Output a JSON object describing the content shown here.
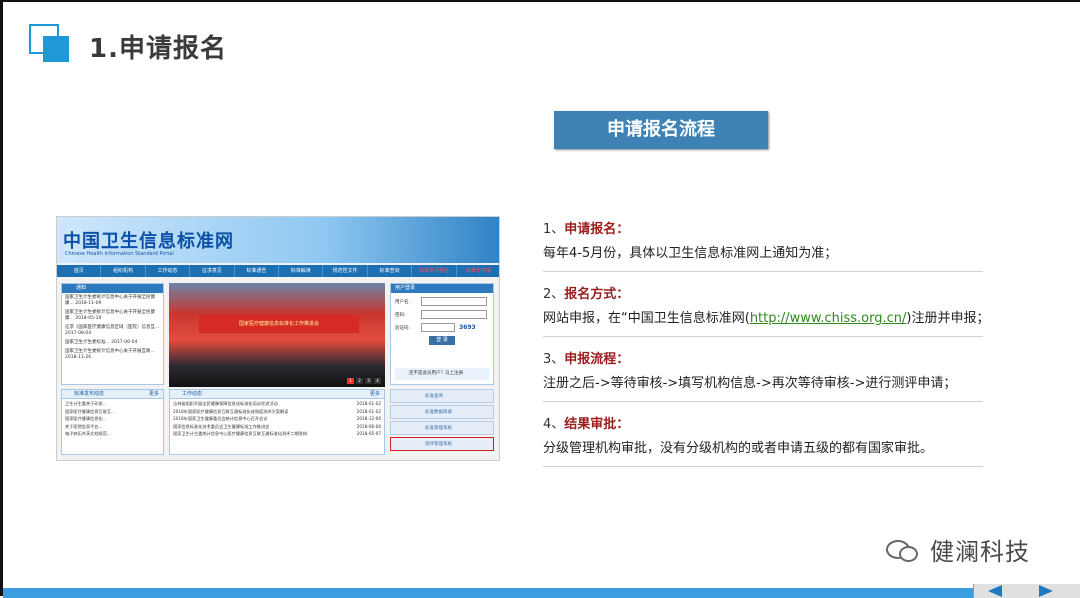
{
  "slide": {
    "title": "1.申请报名",
    "flow_heading": "申请报名流程"
  },
  "website": {
    "title": "中国卫生信息标准网",
    "subtitle": "Chinese Health Information Standard Portal",
    "nav": [
      "首页",
      "组织机构",
      "工作动态",
      "征求意见",
      "标准通告",
      "标准解读",
      "规范性文件",
      "标准查询",
      "标准测评报名",
      "标准化申报"
    ],
    "notice_heading": "通知",
    "notices": [
      "国家卫生计生委统计信息中心关于开展全民健康... 2018-11-09",
      "国家卫生计生委统计信息中心关于开展全民健康... 2018-05-19",
      "征求《国家医疗健康信息区域（医院）信息互... 2017-08-04",
      "国家卫生计生委标准... 2017-06-04",
      "国家卫生计生委统计信息中心关于开展互联... 2018-11-26"
    ],
    "photo_banner": "国家医疗健康信息标准化工作推进会",
    "photo_pages": [
      "1",
      "2",
      "3",
      "4"
    ],
    "login_heading": "用户登录",
    "login_user": "用户名:",
    "login_pass": "密码:",
    "login_code": "验证码:",
    "login_code_value": "3693",
    "login_button": "登 录",
    "login_note": "还不是会员用户？马上注册",
    "std_heading": "标准发布动态",
    "std_more": "更多",
    "std_items": [
      "卫生计生委关于印发...",
      "国家医疗健康信息互联互...",
      "国家医疗健康信息化...",
      "关于医院信息平台...",
      "电子病历共享文档规范..."
    ],
    "work_heading": "工作动态",
    "work_more": "更多",
    "work_items": [
      {
        "t": "吉林省组织开展全民健康保障信息化标准化培训交流活动",
        "d": "2018-01-02"
      },
      {
        "t": "2018年国家医疗健康信息互联互通标准化成熟度测评方案解读",
        "d": "2018-01-02"
      },
      {
        "t": "2018年国家卫生健康委员会统计信息中心召开会议",
        "d": "2018-12-06"
      },
      {
        "t": "国家信息标准化技术委员会卫生健康标准工作推进会",
        "d": "2018-06-06"
      },
      {
        "t": "国家卫生计生委统计信息中心医疗健康信息互联互通标准化测评二期答辩",
        "d": "2018-05-07"
      }
    ],
    "side_buttons": [
      "标准查询",
      "标准数据目录",
      "标准管理系统",
      "测评管理系统"
    ]
  },
  "steps": [
    {
      "num": "1、",
      "title": "申请报名：",
      "text": "每年4-5月份，具体以卫生信息标准网上通知为准；"
    },
    {
      "num": "2、",
      "title": "报名方式：",
      "text_before": "网站申报，在“中国卫生信息标准网(",
      "url": "http://www.chiss.org.cn/",
      "text_after": ")注册并申报；"
    },
    {
      "num": "3、",
      "title": "申报流程：",
      "text": "注册之后->等待审核->填写机构信息->再次等待审核->进行测评申请；"
    },
    {
      "num": "4、",
      "title": "结果审批：",
      "text": "分级管理机构审批，没有分级机构的或者申请五级的都有国家审批。"
    }
  ],
  "watermark": {
    "text": "健澜科技",
    "icon": "wechat-icon"
  },
  "colors": {
    "accent": "#1e98d6",
    "flow_box": "#3f82b5",
    "step_title": "#9d1c1c",
    "url": "#2e8a1a",
    "bottom_bar": "#3c9ee0"
  }
}
